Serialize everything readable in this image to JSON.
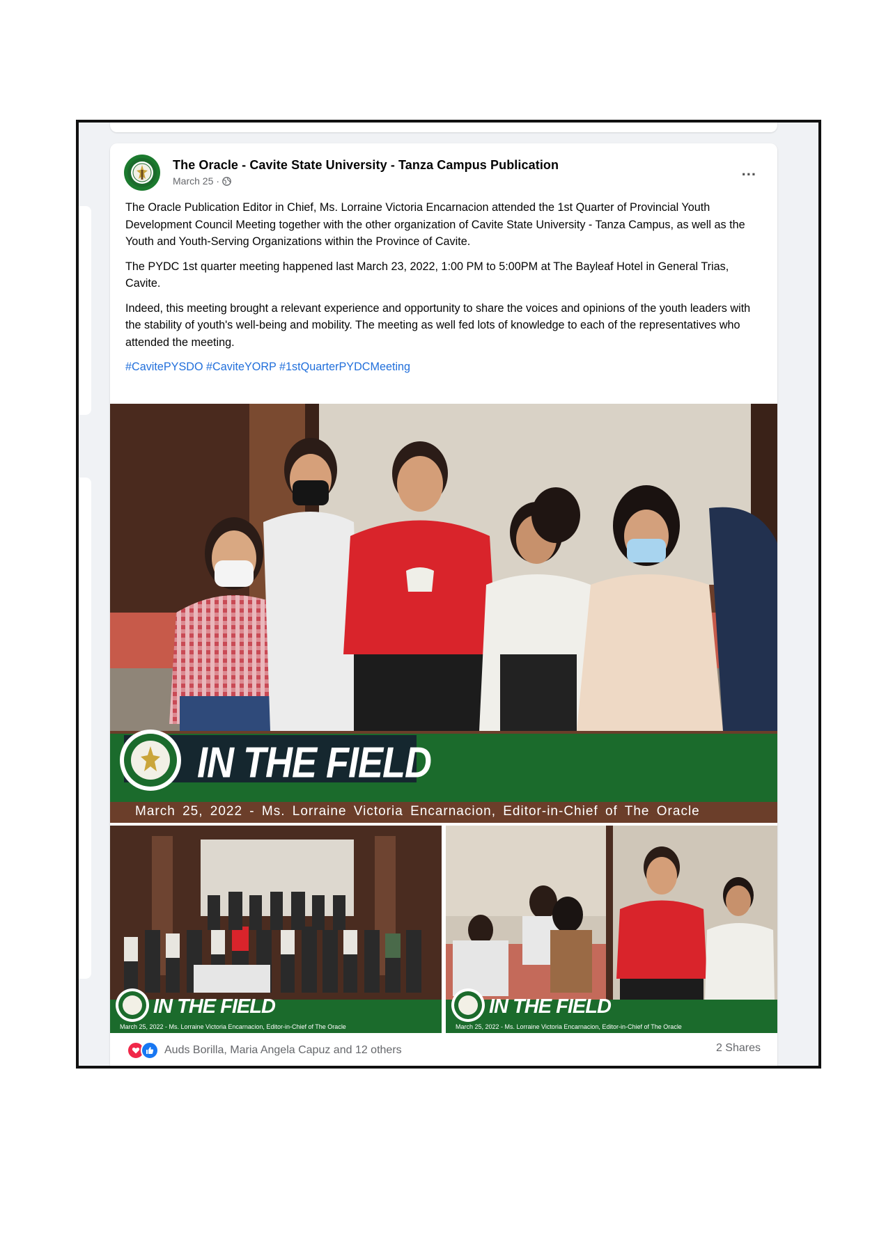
{
  "post": {
    "page_name": "The Oracle - Cavite State University - Tanza Campus Publication",
    "date": "March 25",
    "separator": "·",
    "more_label": "...",
    "paragraphs": [
      "The Oracle Publication Editor in Chief, Ms. Lorraine Victoria Encarnacion attended the 1st Quarter of Provincial Youth Development Council Meeting together with the other organization of Cavite State University - Tanza Campus, as well as the Youth and Youth-Serving Organizations within the Province of Cavite.",
      "The PYDC 1st quarter meeting happened last March 23, 2022, 1:00 PM to 5:00PM at The Bayleaf Hotel in General Trias, Cavite.",
      "Indeed, this meeting brought a relevant experience and opportunity to share the voices and opinions of the youth leaders with the stability of youth's well-being and mobility. The meeting as well fed lots of knowledge to each of the representatives who attended the meeting."
    ],
    "hashtags": "#CavitePYSDO #CaviteYORP #1stQuarterPYDCMeeting"
  },
  "photos": {
    "banner_title": "IN THE FIELD",
    "banner_caption": "March 25, 2022 - Ms. Lorraine Victoria Encarnacion, Editor-in-Chief of The Oracle",
    "logo_text": "The Oracle",
    "small_caption": "March 25, 2022 - Ms. Lorraine Victoria Encarnacion, Editor-in-Chief of The Oracle"
  },
  "footer": {
    "reactions_text": "Auds Borilla, Maria Angela Capuz and 12 others",
    "shares_text": "2 Shares"
  },
  "colors": {
    "brand_green": "#1b6b2c",
    "link_blue": "#216fdb",
    "love_red": "#f02849",
    "like_blue": "#1877f2"
  }
}
